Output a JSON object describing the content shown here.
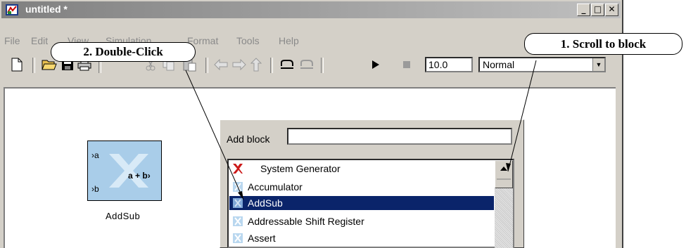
{
  "window": {
    "title": "untitled *"
  },
  "title_buttons": {
    "minimize": "_",
    "maximize": "□",
    "close": "✕"
  },
  "menu": [
    "File",
    "Edit",
    "View",
    "Simulation",
    "Format",
    "Tools",
    "Help"
  ],
  "toolbar": {
    "sim_time": "10.0",
    "sim_mode": "Normal"
  },
  "block": {
    "name": "AddSub",
    "port_a": "a",
    "port_b": "b",
    "op": "a + b"
  },
  "add_block": {
    "label": "Add block",
    "value": ""
  },
  "list": [
    {
      "label": "System Generator",
      "icon": "xilinx-logo-icon",
      "selected": false
    },
    {
      "label": "Accumulator",
      "icon": "block-icon",
      "selected": false
    },
    {
      "label": "AddSub",
      "icon": "block-icon",
      "selected": true
    },
    {
      "label": "Addressable Shift Register",
      "icon": "block-icon",
      "selected": false
    },
    {
      "label": "Assert",
      "icon": "block-icon",
      "selected": false
    }
  ],
  "callouts": {
    "double_click": "2. Double-Click",
    "scroll": "1. Scroll to block"
  },
  "colors": {
    "selection": "#0a246a",
    "block_fill": "#a9cde9",
    "title_bar": "#808080"
  }
}
